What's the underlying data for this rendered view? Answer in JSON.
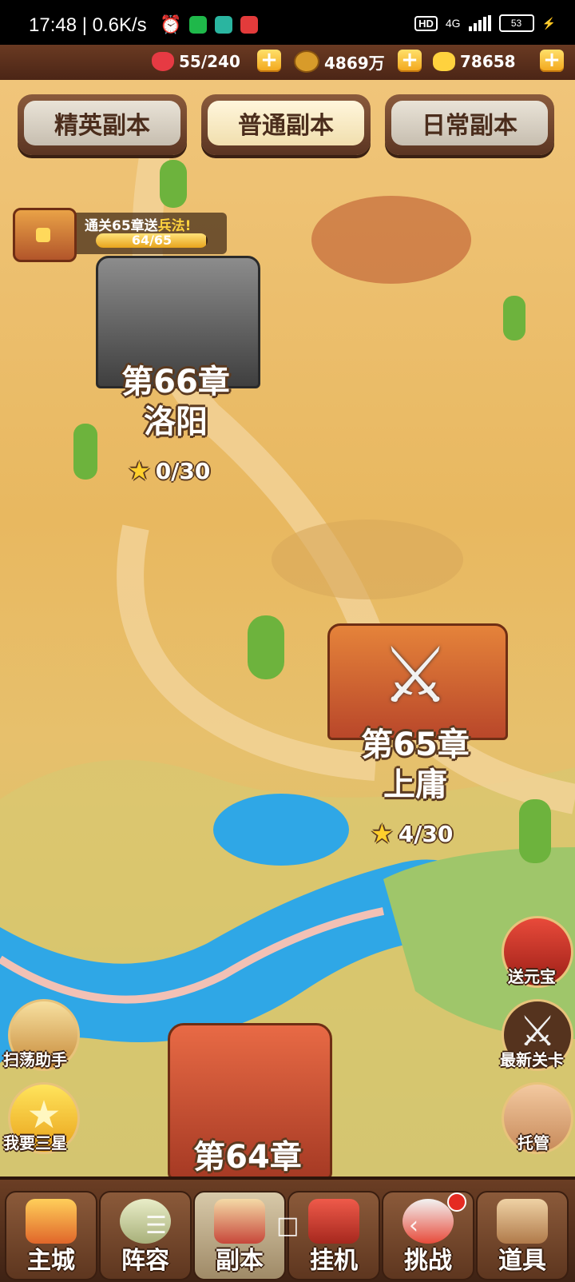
{
  "status_bar": {
    "time": "17:48",
    "speed": "0.6K/s",
    "network": "4G",
    "battery": "53"
  },
  "currency": {
    "stamina": "55/240",
    "copper": "4869万",
    "gold": "78658"
  },
  "tabs": [
    {
      "label": "精英副本",
      "active": false
    },
    {
      "label": "普通副本",
      "active": true
    },
    {
      "label": "日常副本",
      "active": false
    }
  ],
  "reward_banner": {
    "text_prefix": "通关65章送",
    "text_highlight": "兵法!",
    "progress": "64/65",
    "progress_fraction": 0.985
  },
  "chapters": [
    {
      "title": "第66章",
      "name": "洛阳",
      "stars": "0/30"
    },
    {
      "title": "第65章",
      "name": "上庸",
      "stars": "4/30"
    },
    {
      "title": "第64章"
    }
  ],
  "side_buttons": {
    "sweep": "扫荡助手",
    "three_star": "我要三星",
    "ingot": "送元宝",
    "latest": "最新关卡",
    "auto": "托管"
  },
  "bottom_nav": [
    {
      "label": "主城"
    },
    {
      "label": "阵容"
    },
    {
      "label": "副本",
      "active": true
    },
    {
      "label": "挂机"
    },
    {
      "label": "挑战",
      "badge": true
    },
    {
      "label": "道具"
    }
  ],
  "colors": {
    "sand": "#e8b860",
    "water": "#2fa7e6",
    "accent": "#f2a51a"
  }
}
